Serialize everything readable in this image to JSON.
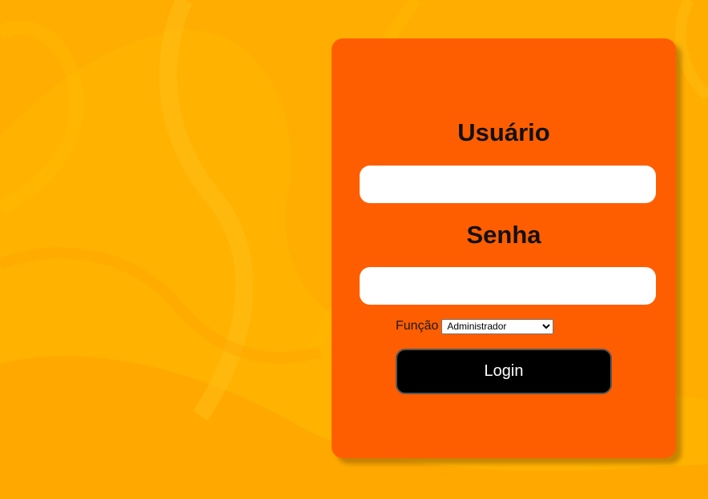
{
  "colors": {
    "background": "#ffad00",
    "card": "#ff5e00",
    "button": "#000000",
    "button_text": "#ffffff",
    "input": "#ffffff"
  },
  "background": {
    "decoration": "abstract-wavy-orange-pattern"
  },
  "login_form": {
    "username_label": "Usuário",
    "username_value": "",
    "password_label": "Senha",
    "password_value": "",
    "role_label": "Função",
    "role_selected": "Administrador",
    "role_options": [
      "Administrador"
    ],
    "submit_label": "Login"
  }
}
